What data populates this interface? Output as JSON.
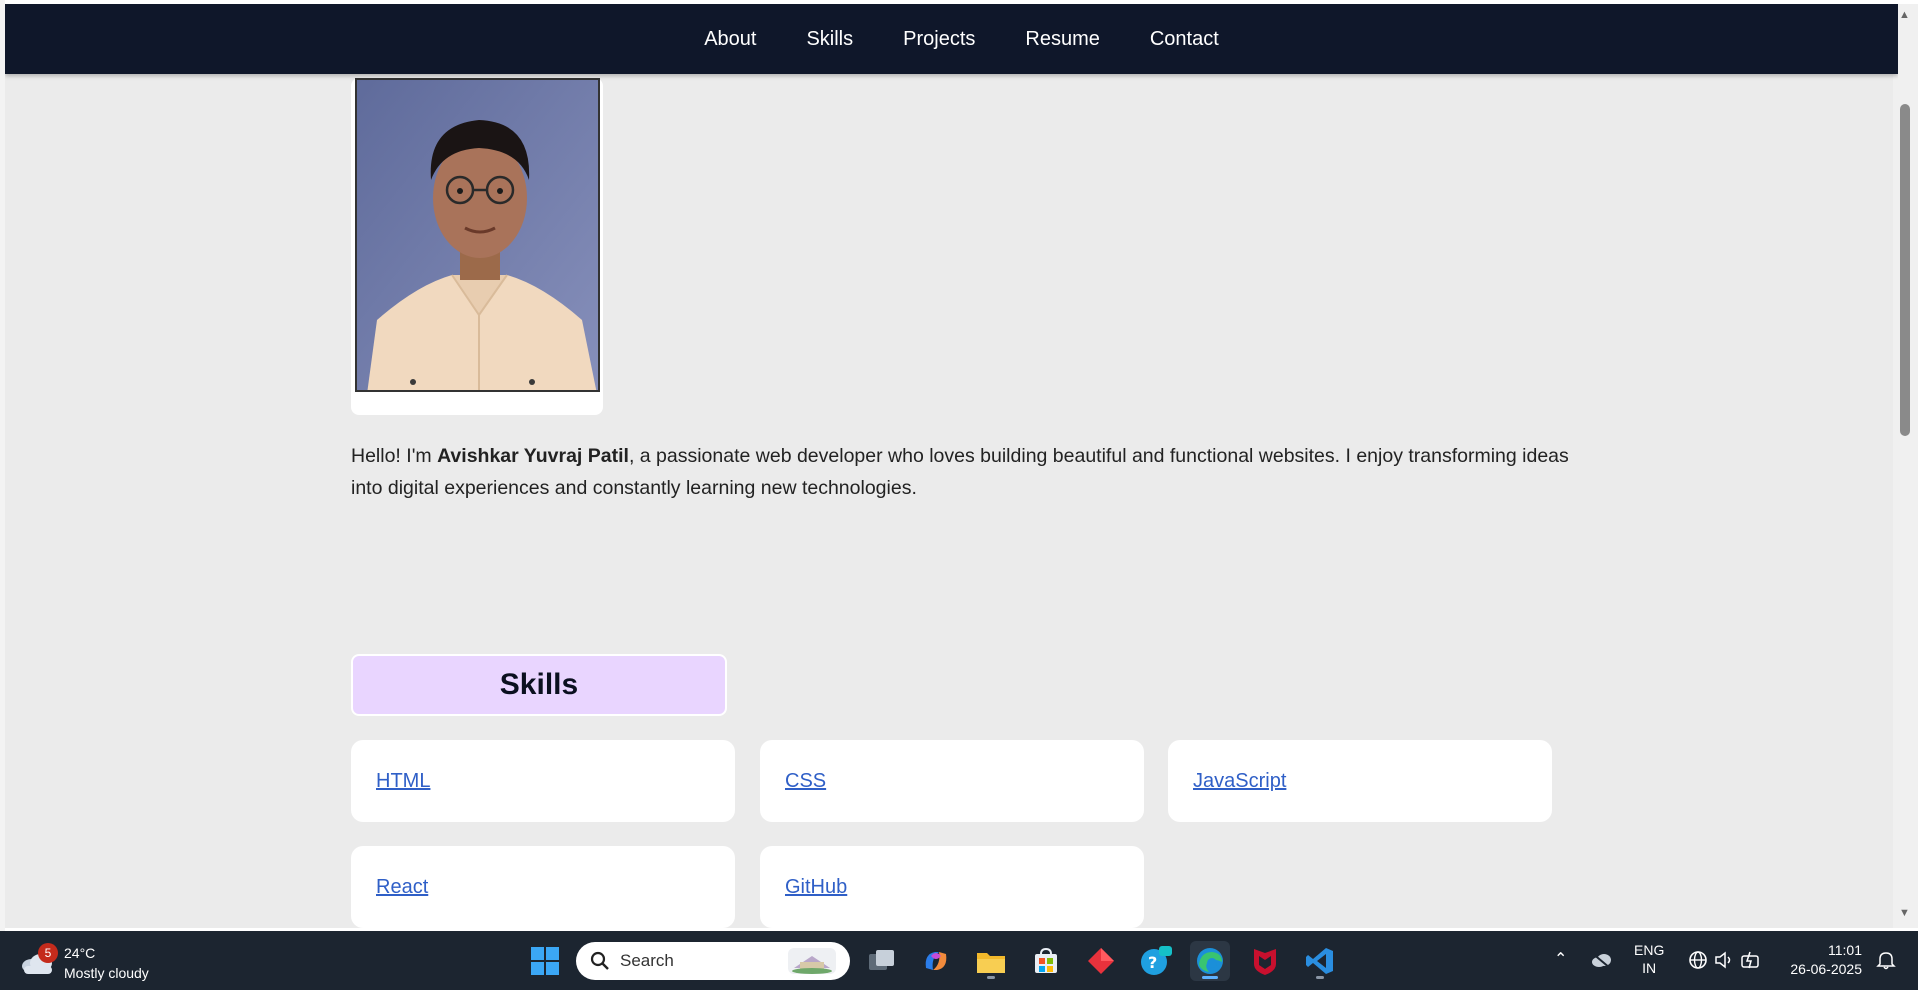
{
  "nav": {
    "links": [
      "About",
      "Skills",
      "Projects",
      "Resume",
      "Contact"
    ]
  },
  "intro": {
    "prefix": "Hello! I'm ",
    "name": "Avishkar Yuvraj Patil",
    "suffix": ", a passionate web developer who loves building beautiful and functional websites. I enjoy transforming ideas into digital experiences and constantly learning new technologies."
  },
  "skills": {
    "heading": "Skills",
    "items": [
      "HTML",
      "CSS",
      "JavaScript",
      "React",
      "GitHub"
    ]
  },
  "colors": {
    "navbar_bg": "#0f172a",
    "page_bg": "#ebebeb",
    "skills_heading_bg": "#e9d5ff",
    "link": "#2f5fc7"
  },
  "taskbar": {
    "weather": {
      "badge": "5",
      "temp": "24°C",
      "desc": "Mostly cloudy"
    },
    "search_placeholder": "Search",
    "language": {
      "line1": "ENG",
      "line2": "IN"
    },
    "clock": {
      "time": "11:01",
      "date": "26-06-2025"
    },
    "apps": [
      "windows-start-icon",
      "task-view-icon",
      "copilot-icon",
      "file-explorer-icon",
      "microsoft-store-icon",
      "red-diamond-app-icon",
      "chat-app-icon",
      "edge-browser-icon",
      "mcafee-icon",
      "vscode-icon"
    ]
  }
}
